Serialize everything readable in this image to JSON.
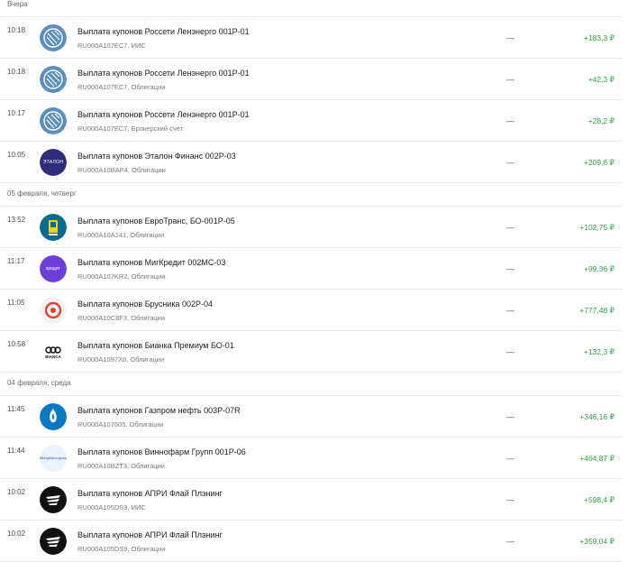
{
  "groups": [
    {
      "date": "Вчера",
      "items": [
        {
          "time": "10:18",
          "title": "Выплата купонов Россети Ленэнерго 001Р-01",
          "isin": "RU000A107EC7",
          "account": "ИИС",
          "status": "—",
          "amount": "+183,3 ₽",
          "logo": "rosseti-logo"
        },
        {
          "time": "10:18",
          "title": "Выплата купонов Россети Ленэнерго 001Р-01",
          "isin": "RU000A107EC7",
          "account": "Облигации",
          "status": "—",
          "amount": "+42,3 ₽",
          "logo": "rosseti-logo"
        },
        {
          "time": "10:17",
          "title": "Выплата купонов Россети Ленэнерго 001Р-01",
          "isin": "RU000A107EC7",
          "account": "Брокерский счёт",
          "status": "—",
          "amount": "+28,2 ₽",
          "logo": "rosseti-logo"
        },
        {
          "time": "10:05",
          "title": "Выплата купонов Эталон Финанс 002Р-03",
          "isin": "RU000A10BAP4",
          "account": "Облигации",
          "status": "—",
          "amount": "+209,6 ₽",
          "logo": "etalon-logo",
          "logo_text": "ЭТАЛОН"
        }
      ]
    },
    {
      "date": "05 февраля, четверг",
      "items": [
        {
          "time": "13:52",
          "title": "Выплата купонов ЕвроТранс, БО-001Р-05",
          "isin": "RU000A10A141",
          "account": "Облигации",
          "status": "—",
          "amount": "+102,75 ₽",
          "logo": "evrotrans-logo"
        },
        {
          "time": "11:17",
          "title": "Выплата купонов МигКредит 002МС-03",
          "isin": "RU000A107KR2",
          "account": "Облигации",
          "status": "—",
          "amount": "+99,36 ₽",
          "logo": "migkredit-logo",
          "logo_text": "кредит"
        },
        {
          "time": "11:05",
          "title": "Выплата купонов Брусника 002Р-04",
          "isin": "RU000A10C8F3",
          "account": "Облигации",
          "status": "—",
          "amount": "+777,48 ₽",
          "logo": "brusnika-logo"
        },
        {
          "time": "10:58",
          "title": "Выплата купонов Бианка Премиум БО-01",
          "isin": "RU000A1097X8",
          "account": "Облигации",
          "status": "—",
          "amount": "+132,3 ₽",
          "logo": "bianca-logo",
          "logo_text": "BIANCA"
        }
      ]
    },
    {
      "date": "04 февраля, среда",
      "items": [
        {
          "time": "11:45",
          "title": "Выплата купонов Газпром нефть 003Р-07R",
          "isin": "RU000A107605",
          "account": "Облигации",
          "status": "—",
          "amount": "+346,16 ₽",
          "logo": "gazpromneft-logo"
        },
        {
          "time": "11:44",
          "title": "Выплата купонов Виннофарм Групп 001Р-06",
          "isin": "RU000A10BZT3",
          "account": "Облигации",
          "status": "—",
          "amount": "+464,87 ₽",
          "logo": "binnopharm-logo",
          "logo_text": "Binnopharm group"
        },
        {
          "time": "10:02",
          "title": "Выплата купонов АПРИ Флай Плэнинг",
          "isin": "RU000A105DS9",
          "account": "ИИС",
          "status": "—",
          "amount": "+598,4 ₽",
          "logo": "apri-logo"
        },
        {
          "time": "10:02",
          "title": "Выплата купонов АПРИ Флай Плэнинг",
          "isin": "RU000A105DS9",
          "account": "Облигации",
          "status": "—",
          "amount": "+359,04 ₽",
          "logo": "apri-logo"
        }
      ]
    }
  ],
  "colors": {
    "amount_positive": "#2e9e48",
    "divider": "#e6e6e6"
  }
}
